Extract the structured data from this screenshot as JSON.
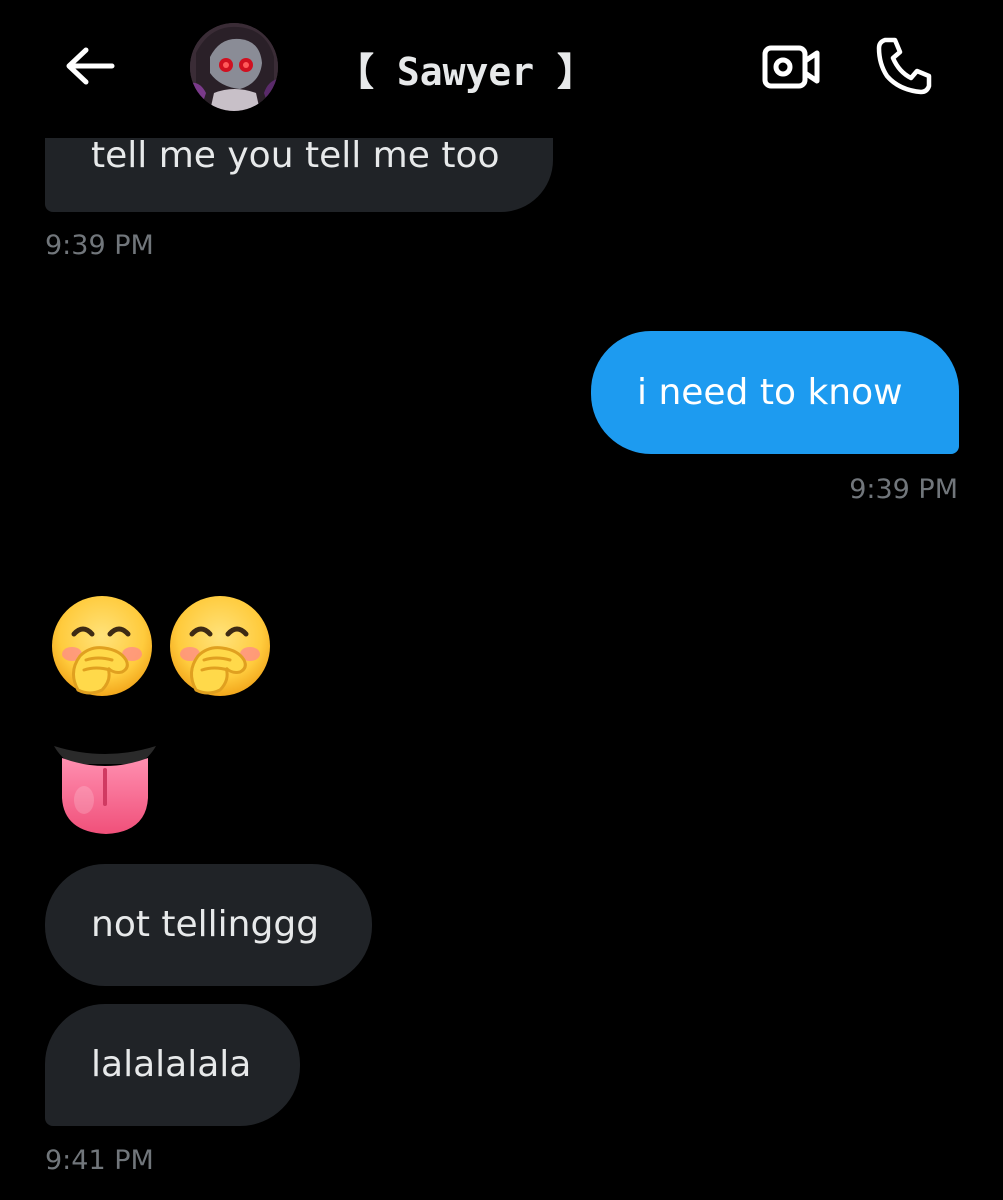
{
  "header": {
    "contact_name": "【 Sawyer 】",
    "icons": {
      "back": "arrow-left-icon",
      "video": "video-camera-icon",
      "phone": "phone-icon"
    }
  },
  "messages": [
    {
      "sender": "contact",
      "text": "tell me you tell me too",
      "time": "9:39 PM"
    },
    {
      "sender": "me",
      "text": "i need to know",
      "time": "9:39 PM"
    },
    {
      "sender": "contact",
      "emoji": [
        "face-with-hand-over-mouth",
        "face-with-hand-over-mouth"
      ]
    },
    {
      "sender": "contact",
      "emoji": [
        "tongue"
      ]
    },
    {
      "sender": "contact",
      "text": "not tellinggg"
    },
    {
      "sender": "contact",
      "text": "lalalalala",
      "time": "9:41 PM"
    }
  ],
  "colors": {
    "background": "#000000",
    "incoming_bubble": "#202327",
    "outgoing_bubble": "#1d9bf0",
    "timestamp": "#71767b",
    "text": "#e7e9ea"
  }
}
